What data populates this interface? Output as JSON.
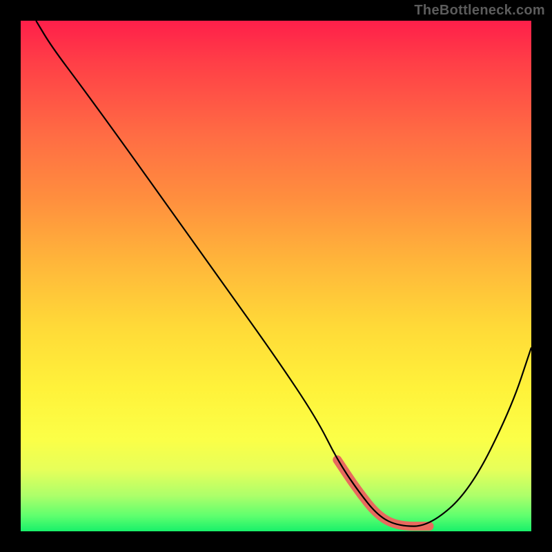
{
  "watermark_text": "TheBottleneck.com",
  "chart_data": {
    "type": "line",
    "title": "",
    "xlabel": "",
    "ylabel": "",
    "xlim": [
      0,
      100
    ],
    "ylim": [
      0,
      100
    ],
    "x": [
      3,
      6,
      12,
      20,
      30,
      40,
      50,
      58,
      62,
      66,
      70,
      74,
      80,
      88,
      96,
      100
    ],
    "values": [
      100,
      95,
      87,
      76,
      62,
      48,
      34,
      22,
      14,
      8,
      3,
      1,
      1,
      8,
      24,
      36
    ],
    "series": [
      {
        "name": "bottleneck-curve",
        "x": [
          3,
          6,
          12,
          20,
          30,
          40,
          50,
          58,
          62,
          66,
          70,
          74,
          80,
          88,
          96,
          100
        ],
        "values": [
          100,
          95,
          87,
          76,
          62,
          48,
          34,
          22,
          14,
          8,
          3,
          1,
          1,
          8,
          24,
          36
        ]
      }
    ],
    "accent_segment": {
      "x_start": 62,
      "x_end": 82
    },
    "background_gradient": {
      "top": "#ff1f4a",
      "mid": "#ffe23a",
      "bottom": "#18f06a"
    }
  }
}
